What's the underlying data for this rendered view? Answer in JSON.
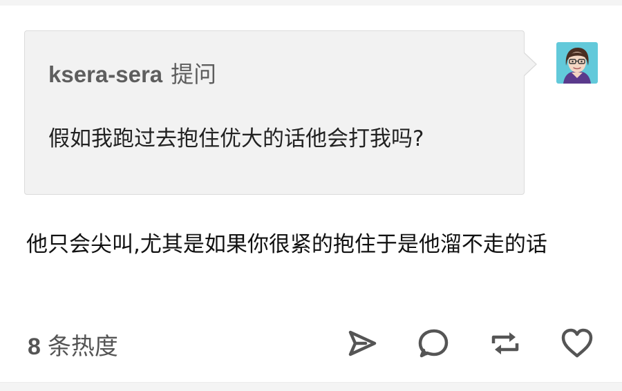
{
  "post": {
    "asker": "ksera-sera",
    "ask_verb": "提问",
    "question": "假如我跑过去抱住优大的话他会打我吗?",
    "answer": "他只会尖叫,尤其是如果你很紧的抱住于是他溜不走的话",
    "notes_count": "8",
    "notes_label": "条热度"
  },
  "icons": {
    "avatar": "avatar-icon",
    "share": "send-icon",
    "reply": "chat-bubble-icon",
    "reblog": "reblog-icon",
    "like": "heart-icon"
  },
  "colors": {
    "bubble_bg": "#f2f2f2",
    "bubble_border": "#dcdcdc",
    "icon_stroke": "#555555",
    "avatar_bg": "#62c9da"
  }
}
